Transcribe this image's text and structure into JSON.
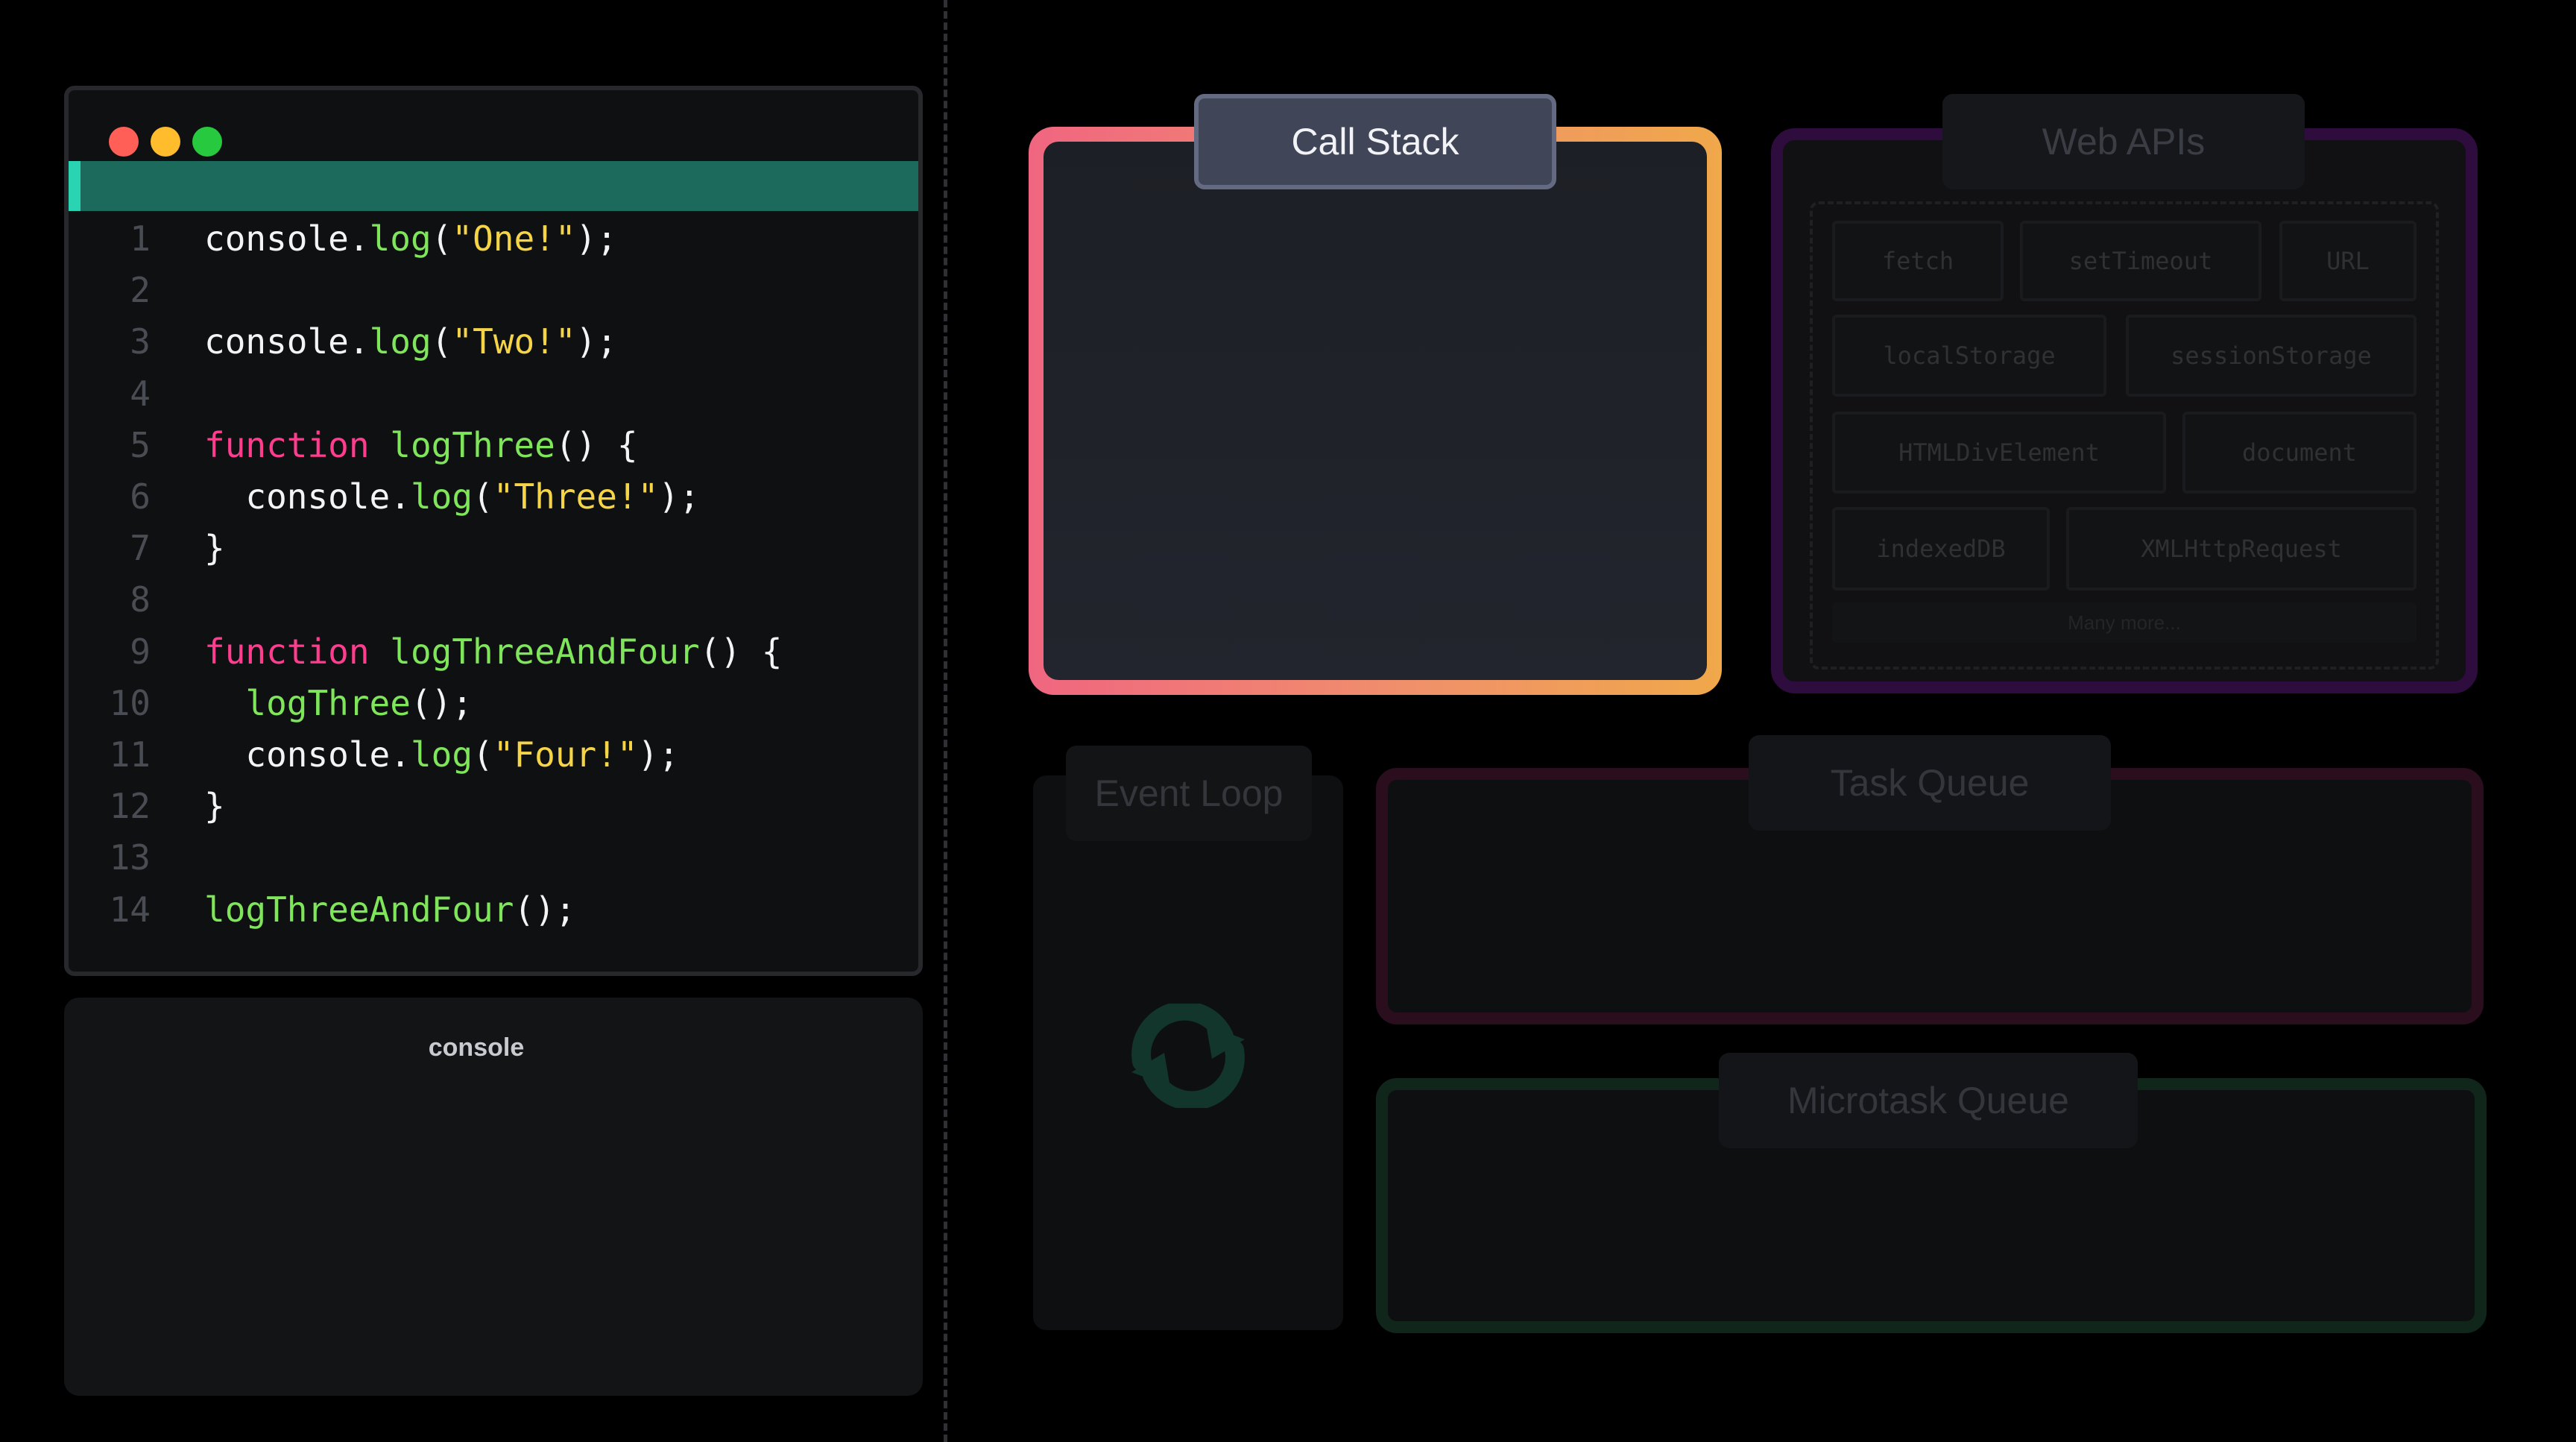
{
  "editor": {
    "current_line": 1,
    "lines": [
      {
        "n": "1",
        "tokens": [
          {
            "t": "console",
            "c": "txt"
          },
          {
            "t": ".",
            "c": "txt"
          },
          {
            "t": "log",
            "c": "fn"
          },
          {
            "t": "(",
            "c": "txt"
          },
          {
            "t": "\"One!\"",
            "c": "str"
          },
          {
            "t": ");",
            "c": "txt"
          }
        ]
      },
      {
        "n": "2",
        "tokens": []
      },
      {
        "n": "3",
        "tokens": [
          {
            "t": "console",
            "c": "txt"
          },
          {
            "t": ".",
            "c": "txt"
          },
          {
            "t": "log",
            "c": "fn"
          },
          {
            "t": "(",
            "c": "txt"
          },
          {
            "t": "\"Two!\"",
            "c": "str"
          },
          {
            "t": ");",
            "c": "txt"
          }
        ]
      },
      {
        "n": "4",
        "tokens": []
      },
      {
        "n": "5",
        "tokens": [
          {
            "t": "function",
            "c": "kw"
          },
          {
            "t": " ",
            "c": "txt"
          },
          {
            "t": "logThree",
            "c": "fn"
          },
          {
            "t": "() {",
            "c": "txt"
          }
        ]
      },
      {
        "n": "6",
        "tokens": [
          {
            "t": "  console",
            "c": "txt"
          },
          {
            "t": ".",
            "c": "txt"
          },
          {
            "t": "log",
            "c": "fn"
          },
          {
            "t": "(",
            "c": "txt"
          },
          {
            "t": "\"Three!\"",
            "c": "str"
          },
          {
            "t": ");",
            "c": "txt"
          }
        ]
      },
      {
        "n": "7",
        "tokens": [
          {
            "t": "}",
            "c": "txt"
          }
        ]
      },
      {
        "n": "8",
        "tokens": []
      },
      {
        "n": "9",
        "tokens": [
          {
            "t": "function",
            "c": "kw"
          },
          {
            "t": " ",
            "c": "txt"
          },
          {
            "t": "logThreeAndFour",
            "c": "fn"
          },
          {
            "t": "() {",
            "c": "txt"
          }
        ]
      },
      {
        "n": "10",
        "tokens": [
          {
            "t": "  ",
            "c": "txt"
          },
          {
            "t": "logThree",
            "c": "fn"
          },
          {
            "t": "();",
            "c": "txt"
          }
        ]
      },
      {
        "n": "11",
        "tokens": [
          {
            "t": "  console",
            "c": "txt"
          },
          {
            "t": ".",
            "c": "txt"
          },
          {
            "t": "log",
            "c": "fn"
          },
          {
            "t": "(",
            "c": "txt"
          },
          {
            "t": "\"Four!\"",
            "c": "str"
          },
          {
            "t": ");",
            "c": "txt"
          }
        ]
      },
      {
        "n": "12",
        "tokens": [
          {
            "t": "}",
            "c": "txt"
          }
        ]
      },
      {
        "n": "13",
        "tokens": []
      },
      {
        "n": "14",
        "tokens": [
          {
            "t": "logThreeAndFour",
            "c": "fn"
          },
          {
            "t": "();",
            "c": "txt"
          }
        ]
      }
    ]
  },
  "console": {
    "title": "console"
  },
  "call_stack": {
    "label": "Call Stack"
  },
  "web_apis": {
    "label": "Web APIs",
    "items": [
      "fetch",
      "setTimeout",
      "URL",
      "localStorage",
      "sessionStorage",
      "HTMLDivElement",
      "document",
      "indexedDB",
      "XMLHttpRequest"
    ],
    "more": "Many more..."
  },
  "event_loop": {
    "label": "Event Loop",
    "icon": "refresh-icon"
  },
  "task_queue": {
    "label": "Task Queue"
  },
  "microtask_queue": {
    "label": "Microtask Queue"
  },
  "colors": {
    "keyword": "#ff3d8e",
    "function": "#7fe55a",
    "string": "#f5d547",
    "highlight": "#1b6a5c",
    "call_stack_gradient": [
      "#f06680",
      "#f0a84a"
    ],
    "web_apis_border": "#2e0c3e",
    "task_queue_border": "#2b0e1e",
    "microtask_queue_border": "#10261b"
  }
}
